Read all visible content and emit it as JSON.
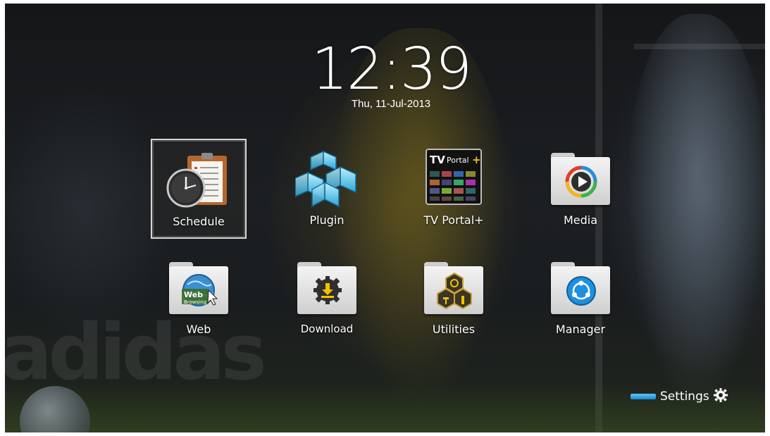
{
  "clock": {
    "time": "12:39",
    "date": "Thu, 11-Jul-2013"
  },
  "menu": {
    "row1": [
      {
        "label": "Schedule",
        "icon": "schedule-clock-clipboard-icon",
        "selected": true
      },
      {
        "label": "Plugin",
        "icon": "plugin-cubes-icon",
        "selected": false
      },
      {
        "label": "TV Portal+",
        "icon": "tv-portal-icon",
        "selected": false,
        "icon_text": "TV Portal+"
      },
      {
        "label": "Media",
        "icon": "media-play-folder-icon",
        "selected": false
      }
    ],
    "row2": [
      {
        "label": "Web",
        "icon": "web-browsing-folder-icon",
        "icon_text": "Web Browsing"
      },
      {
        "label": "Download",
        "icon": "download-folder-icon"
      },
      {
        "label": "Utilities",
        "icon": "utilities-folder-icon"
      },
      {
        "label": "Manager",
        "icon": "manager-folder-icon"
      }
    ]
  },
  "settings": {
    "label": "Settings",
    "color_key": "blue",
    "icon": "gear-icon"
  },
  "colors": {
    "accent_blue": "#3aa8ef",
    "text": "#ffffff"
  }
}
